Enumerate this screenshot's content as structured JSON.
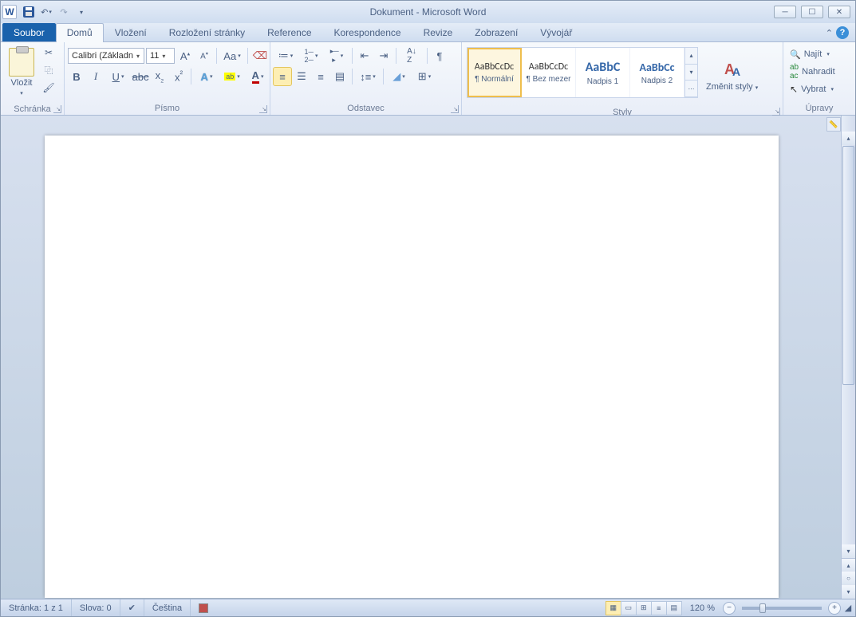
{
  "title": "Dokument  -  Microsoft Word",
  "tabs": {
    "file": "Soubor",
    "list": [
      "Domů",
      "Vložení",
      "Rozložení stránky",
      "Reference",
      "Korespondence",
      "Revize",
      "Zobrazení",
      "Vývojář"
    ],
    "active": 0
  },
  "clipboard": {
    "label": "Schránka",
    "paste": "Vložit"
  },
  "font": {
    "label": "Písmo",
    "name": "Calibri (Základn",
    "size": "11"
  },
  "para": {
    "label": "Odstavec"
  },
  "styles": {
    "label": "Styly",
    "change": "Změnit styly",
    "items": [
      {
        "preview": "AaBbCcDc",
        "name": "¶ Normální",
        "sel": true,
        "size": "12px",
        "color": "#333"
      },
      {
        "preview": "AaBbCcDc",
        "name": "¶ Bez mezer",
        "sel": false,
        "size": "12px",
        "color": "#333"
      },
      {
        "preview": "AaBbC",
        "name": "Nadpis 1",
        "sel": false,
        "size": "16px",
        "color": "#3668a9",
        "weight": "bold"
      },
      {
        "preview": "AaBbCc",
        "name": "Nadpis 2",
        "sel": false,
        "size": "14px",
        "color": "#3668a9",
        "weight": "bold"
      }
    ]
  },
  "editing": {
    "label": "Úpravy",
    "find": "Najít",
    "replace": "Nahradit",
    "select": "Vybrat"
  },
  "status": {
    "page": "Stránka: 1 z 1",
    "words": "Slova: 0",
    "lang": "Čeština",
    "zoom": "120 %"
  }
}
